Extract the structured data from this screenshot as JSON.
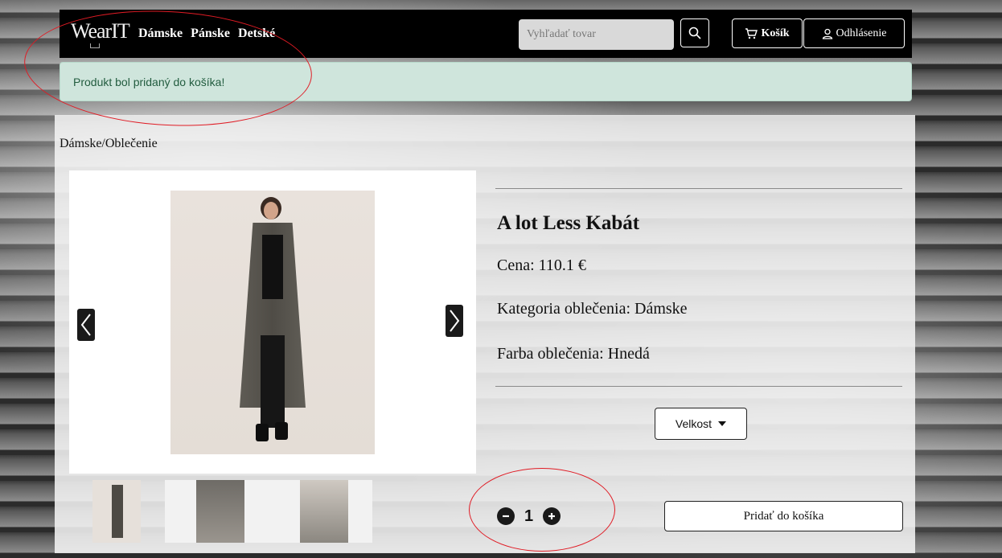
{
  "navbar": {
    "brand": "WearIT",
    "links": [
      "Dámske",
      "Pánske",
      "Detské"
    ],
    "search_placeholder": "Vyhľadať tovar",
    "cart_label": "Košík",
    "logout_label": "Odhlásenie"
  },
  "alert": {
    "message": "Produkt bol pridaný do košíka!"
  },
  "breadcrumb": "Dámske/Oblečenie",
  "product": {
    "title": "A lot Less Kabát",
    "price": "Cena: 110.1 €",
    "category": "Kategoria oblečenia: Dámske",
    "color": "Farba oblečenia: Hnedá",
    "size_label": "Velkost",
    "quantity": "1",
    "add_to_cart": "Pridať do košíka"
  },
  "icons": [
    "search-icon",
    "cart-icon",
    "user-icon",
    "chevron-left-icon",
    "chevron-right-icon",
    "caret-down-icon",
    "minus-icon",
    "plus-icon"
  ]
}
